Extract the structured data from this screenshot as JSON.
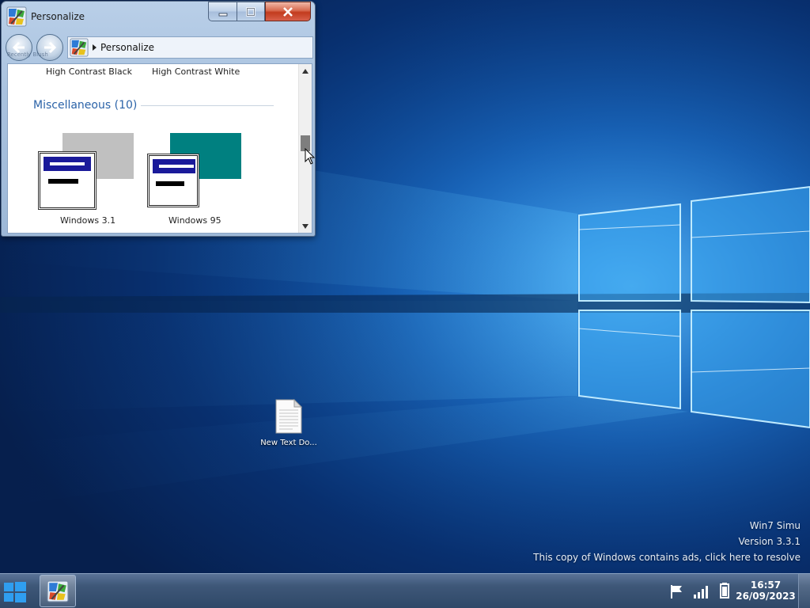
{
  "window": {
    "title": "Personalize",
    "nav_hint": "Recently Blush",
    "address": "Personalize",
    "themes_top": [
      "High Contrast Black",
      "High Contrast White"
    ],
    "section": {
      "title": "Miscellaneous (10)"
    },
    "themes": [
      {
        "label": "Windows 3.1",
        "swatch": "#c0c0c0"
      },
      {
        "label": "Windows 95",
        "swatch": "#008080"
      }
    ]
  },
  "desktop": {
    "icon_label": "New Text Do..."
  },
  "watermark": {
    "line1": "Win7 Simu",
    "line2": "Version 3.3.1",
    "line3": "This copy of Windows contains ads, click here to resolve"
  },
  "taskbar": {
    "time": "16:57",
    "date": "26/09/2023"
  },
  "colors": {
    "desktop": "#0f4fa0",
    "taskbar": "#3e5778",
    "close_button": "#c23b1d",
    "section_header": "#2b63a8",
    "win31_titlebar": "#1a1a9a"
  }
}
